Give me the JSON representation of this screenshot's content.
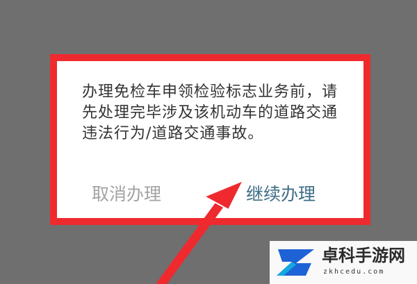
{
  "dialog": {
    "message": "办理免检车申领检验标志业务前，请先处理完毕涉及该机动车的道路交通违法行为/道路交通事故。",
    "cancel_label": "取消办理",
    "continue_label": "继续办理"
  },
  "annotation": {
    "highlight_color": "#ee2a2f",
    "pointer": "red arrow pointing to continue button"
  },
  "watermark": {
    "site_name": "卓科手游网",
    "site_url": "zkhcedu.com"
  },
  "colors": {
    "overlay": "#6f6f6f",
    "continue_text": "#3f6e86",
    "cancel_text": "#a3a3a3",
    "logo_blue": "#1e63d6"
  }
}
